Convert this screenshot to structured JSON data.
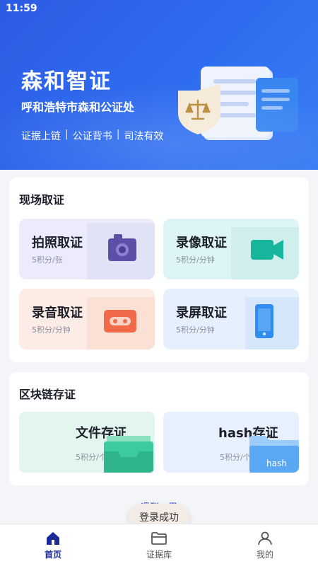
{
  "status_bar": {
    "time": "11:59"
  },
  "hero": {
    "title": "森和智证",
    "subtitle": "呼和浩特市森和公证处",
    "tags": [
      "证据上链",
      "公证背书",
      "司法有效"
    ],
    "tag_separator": "|"
  },
  "onsite": {
    "title": "现场取证",
    "tiles": [
      {
        "label": "拍照取证",
        "price": "5积分/张",
        "icon": "camera-icon"
      },
      {
        "label": "录像取证",
        "price": "5积分/分钟",
        "icon": "video-camera-icon"
      },
      {
        "label": "录音取证",
        "price": "5积分/分钟",
        "icon": "cassette-icon"
      },
      {
        "label": "录屏取证",
        "price": "5积分/分钟",
        "icon": "phone-screen-icon"
      }
    ]
  },
  "blockchain": {
    "title": "区块链存证",
    "tiles": [
      {
        "label": "文件存证",
        "price": "5积分/个",
        "icon": "file-tray-icon"
      },
      {
        "label": "hash存证",
        "price": "5积分/个",
        "icon": "hash-folder-icon",
        "icon_text": "hash"
      }
    ]
  },
  "footer": {
    "link_text": "遇到…里"
  },
  "toast": {
    "text": "登录成功"
  },
  "tabbar": {
    "items": [
      {
        "label": "首页",
        "icon": "home-icon",
        "active": true
      },
      {
        "label": "证据库",
        "icon": "folder-icon",
        "active": false
      },
      {
        "label": "我的",
        "icon": "user-icon",
        "active": false
      }
    ]
  },
  "colors": {
    "primary": "#2f6df0",
    "tab_active": "#1a2a9a"
  }
}
